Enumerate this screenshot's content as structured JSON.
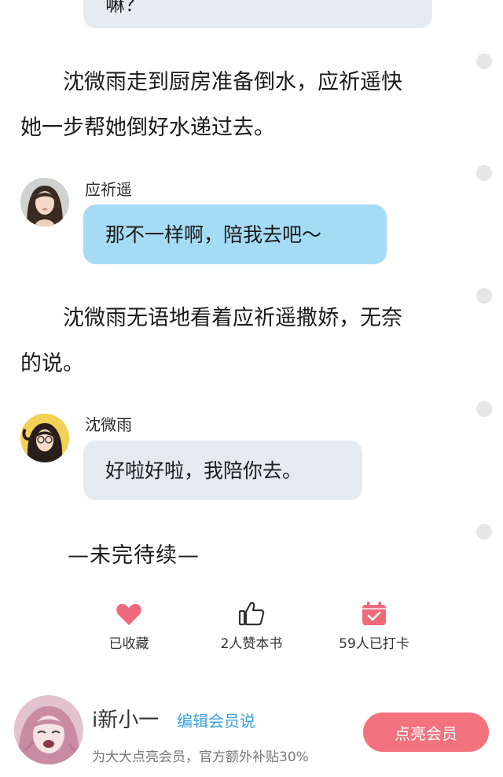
{
  "top_bubble": {
    "text": "嘛？"
  },
  "narration_1": {
    "line1": "沈微雨走到厨房准备倒水，应祈遥快",
    "line2": "她一步帮她倒好水递过去。"
  },
  "message_1": {
    "speaker": "应祈遥",
    "text": "那不一样啊，陪我去吧～",
    "avatar_icon": "girl-portrait-avatar"
  },
  "narration_2": {
    "line1": "沈微雨无语地看着应祈遥撒娇，无奈",
    "line2": "的说。"
  },
  "message_2": {
    "speaker": "沈微雨",
    "text": "好啦好啦，我陪你去。",
    "avatar_icon": "girl-yellow-avatar"
  },
  "end_marker": "—未完待续—",
  "actions": [
    {
      "icon": "heart-icon",
      "label": "已收藏",
      "color": "#f06a7c"
    },
    {
      "icon": "thumbs-up-icon",
      "label": "2人赞本书",
      "color": "#333333"
    },
    {
      "icon": "calendar-check-icon",
      "label": "59人已打卡",
      "color": "#f06a7c"
    }
  ],
  "member": {
    "username": "i新小一",
    "edit_link": "编辑会员说",
    "subtitle": "为大大点亮会员，官方额外补贴30%",
    "button": "点亮会员",
    "accent": "#f2727d",
    "link_color": "#3aa0e0"
  }
}
